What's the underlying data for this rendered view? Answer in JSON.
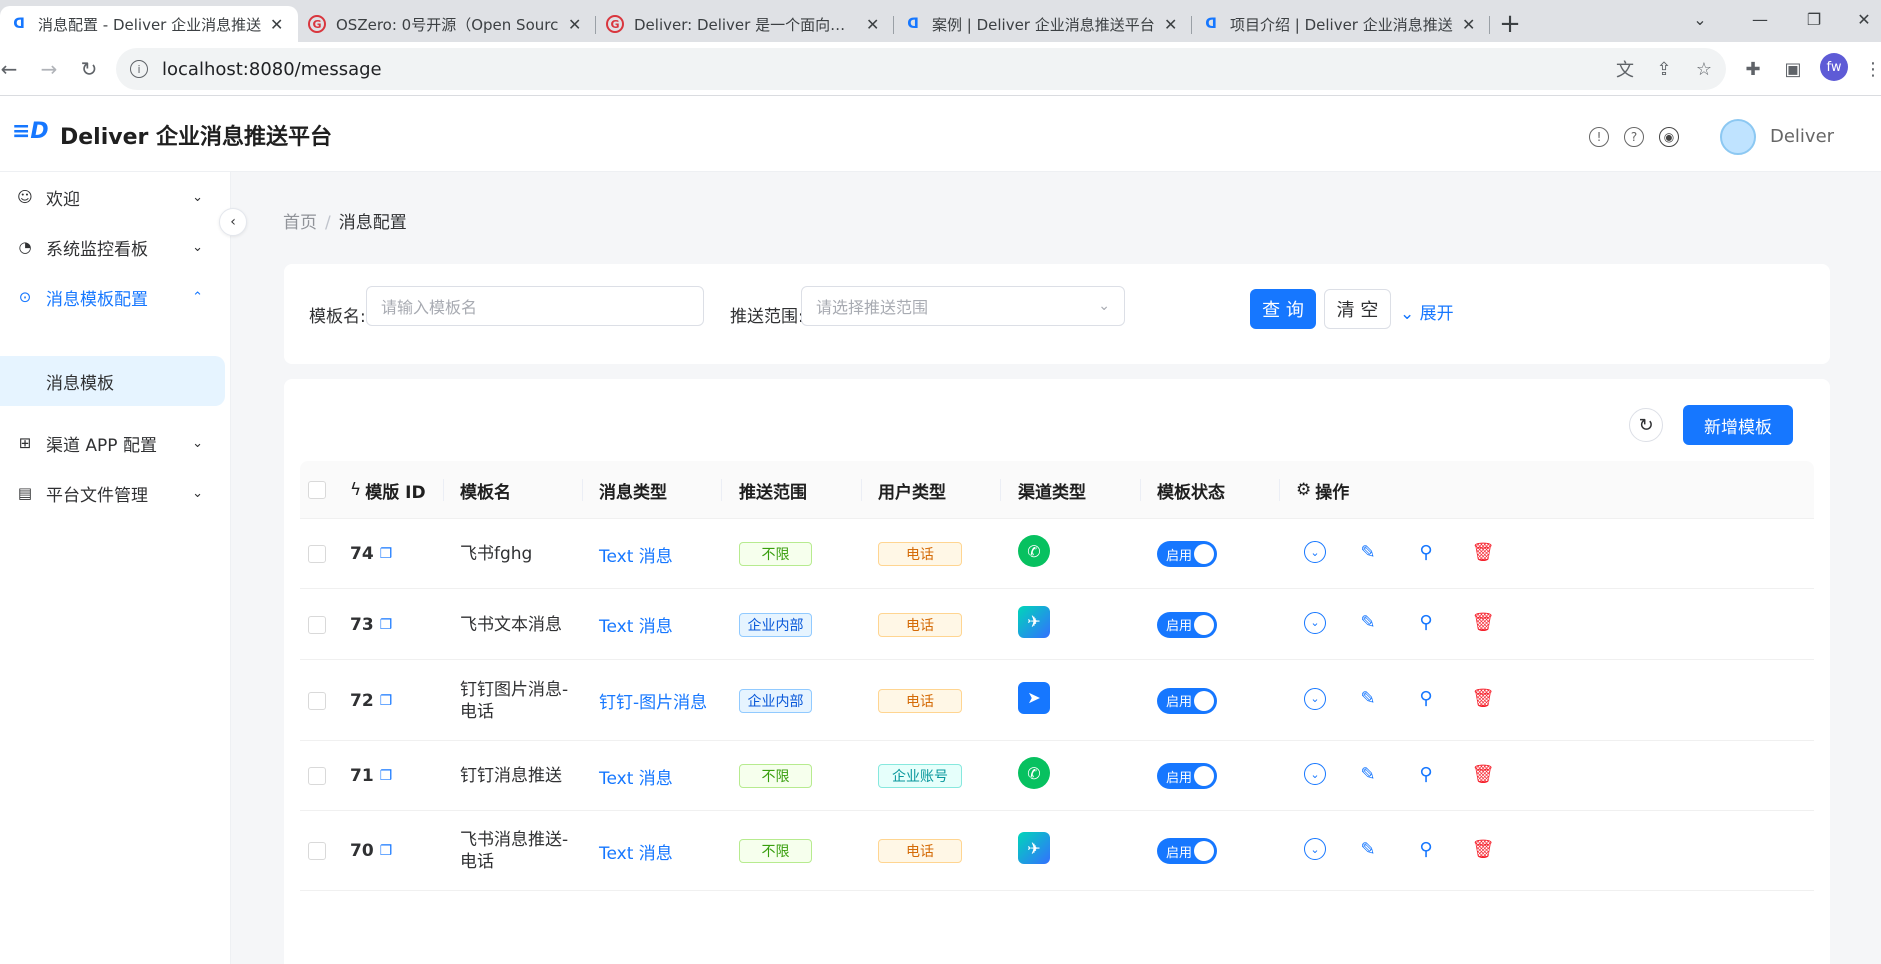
{
  "browser": {
    "tabs": [
      {
        "favicon": "deliver",
        "title": "消息配置 - Deliver 企业消息推送",
        "active": true
      },
      {
        "favicon": "oschina",
        "title": "OSZero: 0号开源（Open Sourc",
        "active": false
      },
      {
        "favicon": "oschina",
        "title": "Deliver: Deliver 是一个面向企业",
        "active": false
      },
      {
        "favicon": "deliver",
        "title": "案例 | Deliver 企业消息推送平台",
        "active": false
      },
      {
        "favicon": "deliver",
        "title": "项目介绍 | Deliver 企业消息推送",
        "active": false
      }
    ],
    "url": "localhost:8080/message",
    "profile_initials": "fw"
  },
  "app": {
    "title": "Deliver 企业消息推送平台",
    "user_name": "Deliver"
  },
  "sidebar": {
    "items": [
      {
        "label": "欢迎",
        "icon": "smile-icon"
      },
      {
        "label": "系统监控看板",
        "icon": "dashboard-icon"
      },
      {
        "label": "消息模板配置",
        "icon": "message-icon"
      },
      {
        "label": "渠道 APP 配置",
        "icon": "grid-icon"
      },
      {
        "label": "平台文件管理",
        "icon": "file-icon"
      }
    ],
    "sub_item": "消息模板"
  },
  "breadcrumb": {
    "home": "首页",
    "current": "消息配置"
  },
  "search": {
    "template_name_label": "模板名:",
    "template_name_placeholder": "请输入模板名",
    "scope_label": "推送范围:",
    "scope_placeholder": "请选择推送范围",
    "query_button": "查 询",
    "clear_button": "清 空",
    "expand_link": "展开"
  },
  "table": {
    "add_button": "新增模板",
    "headers": {
      "id": "模版 ID",
      "name": "模板名",
      "msg_type": "消息类型",
      "scope": "推送范围",
      "user_type": "用户类型",
      "channel": "渠道类型",
      "status": "模板状态",
      "actions": "操作"
    },
    "rows": [
      {
        "id": "74",
        "name": "飞书fghg",
        "msg_type": "Text 消息",
        "scope": "不限",
        "user_type": "电话",
        "channel": "phone",
        "status": "启用"
      },
      {
        "id": "73",
        "name": "飞书文本消息",
        "msg_type": "Text 消息",
        "scope": "企业内部",
        "user_type": "电话",
        "channel": "feishu",
        "status": "启用"
      },
      {
        "id": "72",
        "name": "钉钉图片消息-电话",
        "msg_type": "钉钉-图片消息",
        "scope": "企业内部",
        "user_type": "电话",
        "channel": "dingtalk",
        "status": "启用"
      },
      {
        "id": "71",
        "name": "钉钉消息推送",
        "msg_type": "Text 消息",
        "scope": "不限",
        "user_type": "企业账号",
        "channel": "phone",
        "status": "启用"
      },
      {
        "id": "70",
        "name": "飞书消息推送-电话",
        "msg_type": "Text 消息",
        "scope": "不限",
        "user_type": "电话",
        "channel": "feishu",
        "status": "启用"
      }
    ]
  },
  "colors": {
    "accent": "#1677ff",
    "danger": "#f5222d",
    "background": "#f5f6f8"
  }
}
